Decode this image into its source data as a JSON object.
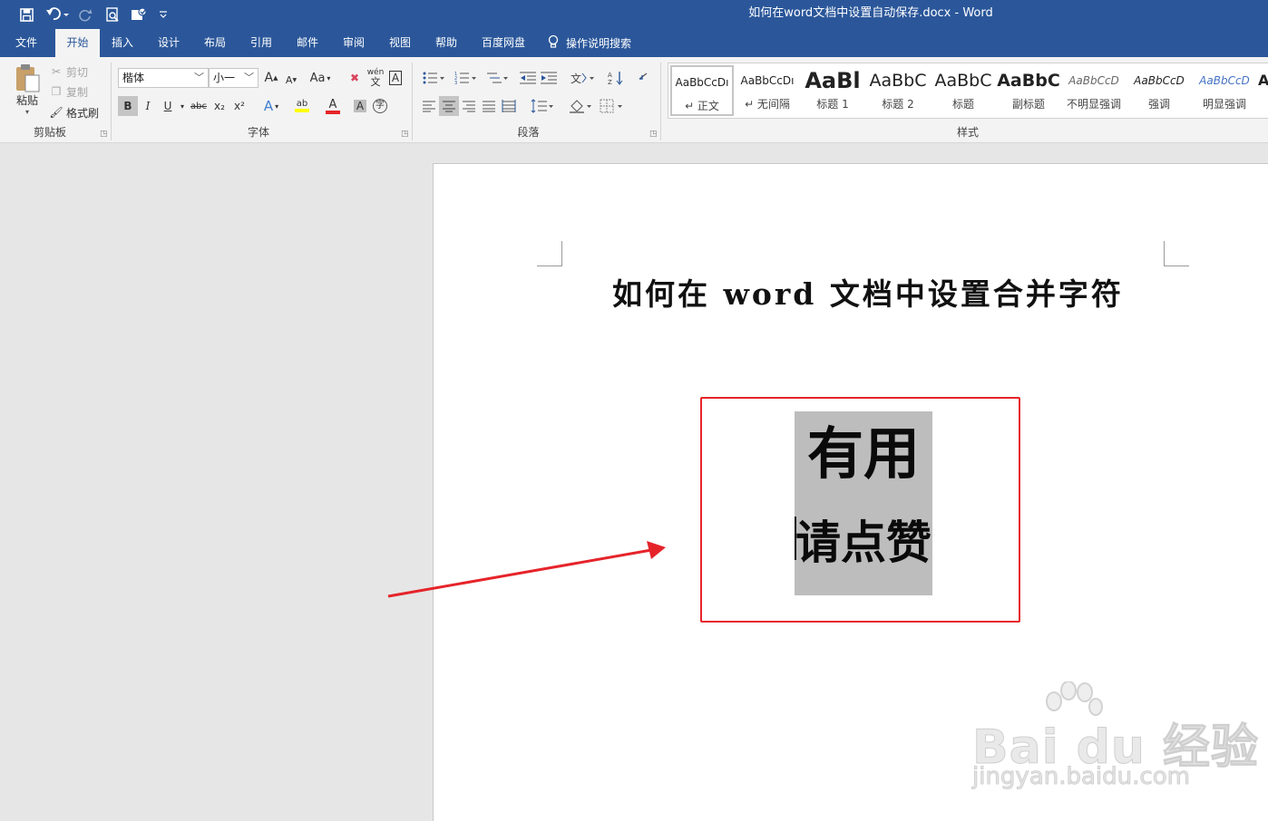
{
  "window": {
    "title": "如何在word文档中设置自动保存.docx  -  Word"
  },
  "quick_access": {
    "save": "💾",
    "undo": "↶",
    "redo": "↻",
    "preview": "⎙",
    "touch": "✥",
    "customize": "▿"
  },
  "tabs": [
    "文件",
    "开始",
    "插入",
    "设计",
    "布局",
    "引用",
    "邮件",
    "审阅",
    "视图",
    "帮助",
    "百度网盘"
  ],
  "active_tab": "开始",
  "tell_me": "操作说明搜索",
  "clipboard": {
    "paste": "粘贴",
    "cut": "剪切",
    "copy": "复制",
    "format_painter": "格式刷",
    "group": "剪贴板"
  },
  "font": {
    "name": "楷体",
    "size": "小一",
    "group": "字体",
    "grow": "A",
    "shrink": "A",
    "case": "Aa",
    "clear": "✖",
    "phonetic": "wén",
    "border": "A",
    "bold": "B",
    "italic": "I",
    "underline": "U",
    "strike": "abc",
    "sub": "x₂",
    "sup": "x²",
    "effects": "A",
    "highlight": "ab",
    "color": "A",
    "shading": "A",
    "enclose": "字"
  },
  "paragraph": {
    "group": "段落"
  },
  "styles": {
    "group": "样式",
    "items": [
      {
        "sample": "AaBbCcDı",
        "name": "↵ 正文"
      },
      {
        "sample": "AaBbCcDı",
        "name": "↵ 无间隔"
      },
      {
        "sample": "AaBl",
        "name": "标题 1"
      },
      {
        "sample": "AaBbC",
        "name": "标题 2"
      },
      {
        "sample": "AaBbC",
        "name": "标题"
      },
      {
        "sample": "AaBbC",
        "name": "副标题"
      },
      {
        "sample": "AaBbCcD",
        "name": "不明显强调"
      },
      {
        "sample": "AaBbCcD",
        "name": "强调"
      },
      {
        "sample": "AaBbCcD",
        "name": "明显强调"
      },
      {
        "sample": "A",
        "name": ""
      }
    ]
  },
  "document": {
    "heading": "如何在 word 文档中设置合并字符",
    "combined_line1": "有用",
    "combined_line2": "请点赞"
  },
  "watermark": {
    "brand": "Bai du 经验",
    "url": "jingyan.baidu.com"
  },
  "colors": {
    "accent": "#2b579a",
    "annotation": "#e5242a",
    "highlight_gray": "#bdbdbd"
  }
}
